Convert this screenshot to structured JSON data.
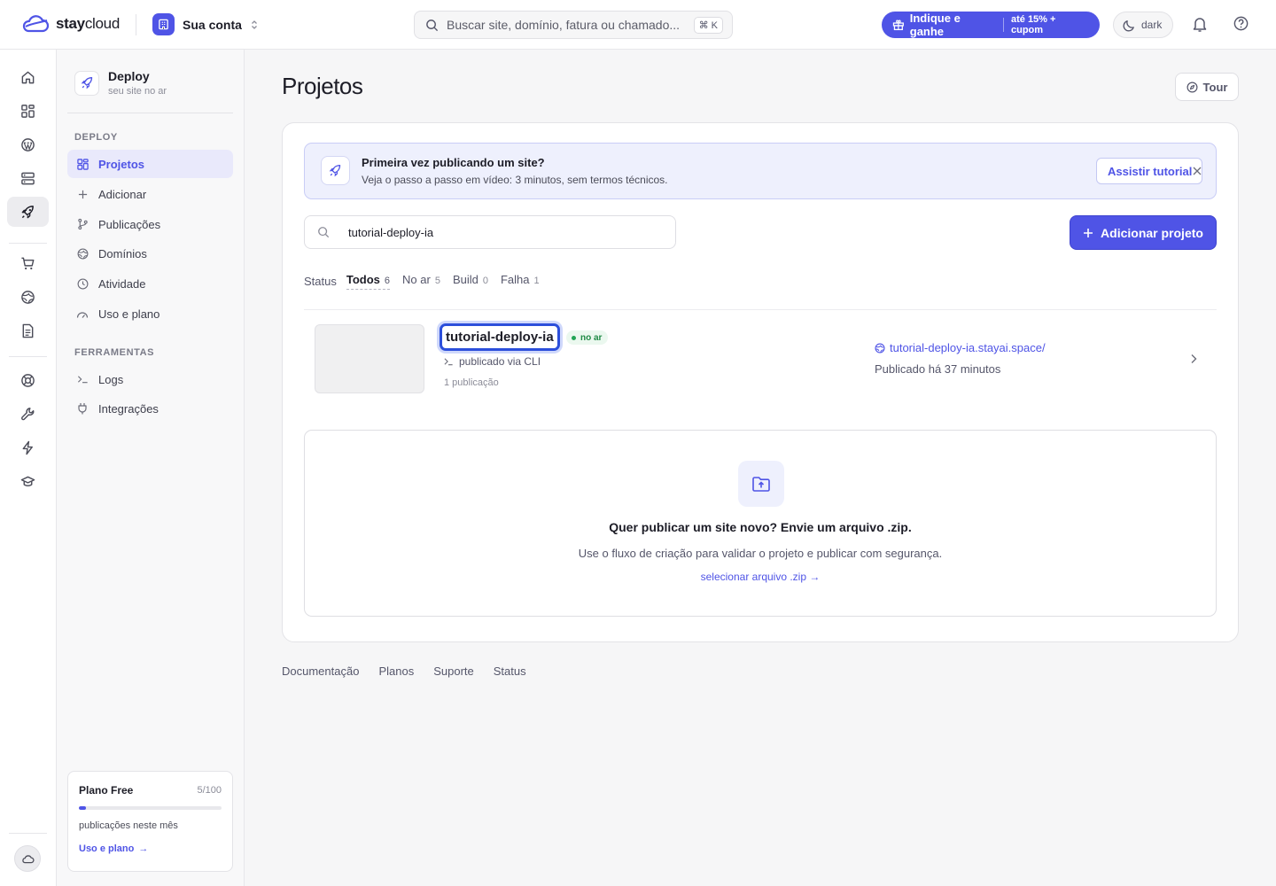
{
  "brand": {
    "name_bold": "stay",
    "name_light": "cloud"
  },
  "account": {
    "label": "Sua conta"
  },
  "search": {
    "placeholder": "Buscar site, domínio, fatura ou chamado...",
    "shortcut": "⌘ K"
  },
  "referral": {
    "label": "Indique e ganhe",
    "badge": "até 15% + cupom"
  },
  "theme_toggle": {
    "label": "dark"
  },
  "colors": {
    "accent": "#4f54e6",
    "live": "#22a455",
    "focus_ring": "#2c4fdb"
  },
  "rail": {
    "items": [
      {
        "icon": "home-icon"
      },
      {
        "icon": "dashboard-icon"
      },
      {
        "icon": "wordpress-icon"
      },
      {
        "icon": "server-icon"
      },
      {
        "icon": "rocket-icon",
        "active": true
      },
      {
        "icon": "cart-icon"
      },
      {
        "icon": "globe-icon"
      },
      {
        "icon": "invoice-icon"
      },
      {
        "icon": "support-icon"
      },
      {
        "icon": "wrench-icon"
      },
      {
        "icon": "bolt-icon"
      },
      {
        "icon": "graduation-icon"
      }
    ]
  },
  "sidebar": {
    "title": "Deploy",
    "subtitle": "seu site no ar",
    "section_deploy": "DEPLOY",
    "section_tools": "FERRAMENTAS",
    "deploy_items": [
      {
        "label": "Projetos",
        "icon": "grid-icon",
        "active": true
      },
      {
        "label": "Adicionar",
        "icon": "plus-icon"
      },
      {
        "label": "Publicações",
        "icon": "branch-icon"
      },
      {
        "label": "Domínios",
        "icon": "globe-icon"
      },
      {
        "label": "Atividade",
        "icon": "clock-icon"
      },
      {
        "label": "Uso e plano",
        "icon": "gauge-icon"
      }
    ],
    "tool_items": [
      {
        "label": "Logs",
        "icon": "terminal-icon"
      },
      {
        "label": "Integrações",
        "icon": "plug-icon"
      }
    ],
    "plan": {
      "name": "Plano Free",
      "count": "5/100",
      "progress": 0.05,
      "note": "publicações neste mês",
      "link": "Uso e plano",
      "arrow": "→"
    }
  },
  "main": {
    "title": "Projetos",
    "tour_label": "Tour",
    "banner": {
      "title": "Primeira vez publicando um site?",
      "subtitle": "Veja o passo a passo em vídeo: 3 minutos, sem termos técnicos.",
      "button": "Assistir tutorial"
    },
    "project_search": {
      "value": "tutorial-deploy-ia"
    },
    "add_button": "Adicionar projeto",
    "filters": {
      "label": "Status",
      "items": [
        {
          "label": "Todos",
          "count": "6",
          "active": true
        },
        {
          "label": "No ar",
          "count": "5"
        },
        {
          "label": "Build",
          "count": "0"
        },
        {
          "label": "Falha",
          "count": "1"
        }
      ]
    },
    "projects": [
      {
        "name": "tutorial-deploy-ia",
        "status": "no ar",
        "source": "publicado via CLI",
        "publications": "1 publicação",
        "url": "tutorial-deploy-ia.stayai.space/",
        "published": "Publicado há 37 minutos"
      }
    ],
    "upload": {
      "title": "Quer publicar um site novo? Envie um arquivo .zip.",
      "subtitle": "Use o fluxo de criação para validar o projeto e publicar com segurança.",
      "link": "selecionar arquivo .zip →"
    }
  },
  "footer": {
    "links": [
      "Documentação",
      "Planos",
      "Suporte",
      "Status"
    ]
  }
}
